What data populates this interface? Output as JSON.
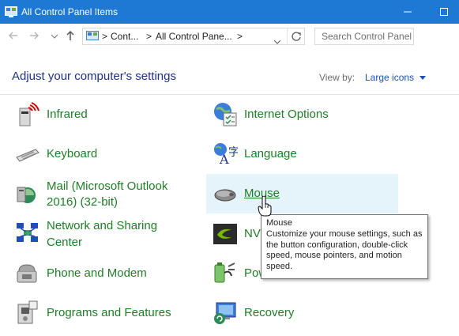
{
  "window": {
    "title": "All Control Panel Items"
  },
  "address": {
    "crumb1": "Cont...",
    "crumb2": "All Control Pane...",
    "search_placeholder": "Search Control Panel"
  },
  "header": {
    "heading": "Adjust your computer's settings",
    "view_by_label": "View by:",
    "view_by_value": "Large icons"
  },
  "items": {
    "infrared": "Infrared",
    "internet_options": "Internet Options",
    "keyboard": "Keyboard",
    "language": "Language",
    "mail_line1": "Mail (Microsoft Outlook",
    "mail_line2": "2016) (32-bit)",
    "mouse": "Mouse",
    "network_line1": "Network and Sharing",
    "network_line2": "Center",
    "nvidia": "NV",
    "phone": "Phone and Modem",
    "power": "Pow",
    "programs": "Programs and Features",
    "recovery": "Recovery"
  },
  "tooltip": {
    "title": "Mouse",
    "body": "Customize your mouse settings, such as the button configuration, double-click speed, mouse pointers, and motion speed."
  },
  "colors": {
    "titlebar": "#1d79d4",
    "link_green": "#1f7d28",
    "heading_blue": "#1e3287",
    "hover": "#e5f3fb"
  },
  "icons": [
    "control-panel-icon",
    "back-arrow-icon",
    "forward-arrow-icon",
    "up-arrow-icon",
    "refresh-icon",
    "infrared-icon",
    "internet-options-icon",
    "keyboard-icon",
    "language-icon",
    "mail-icon",
    "mouse-icon",
    "network-icon",
    "nvidia-icon",
    "phone-modem-icon",
    "power-icon",
    "programs-icon",
    "recovery-icon",
    "hand-cursor-icon"
  ]
}
